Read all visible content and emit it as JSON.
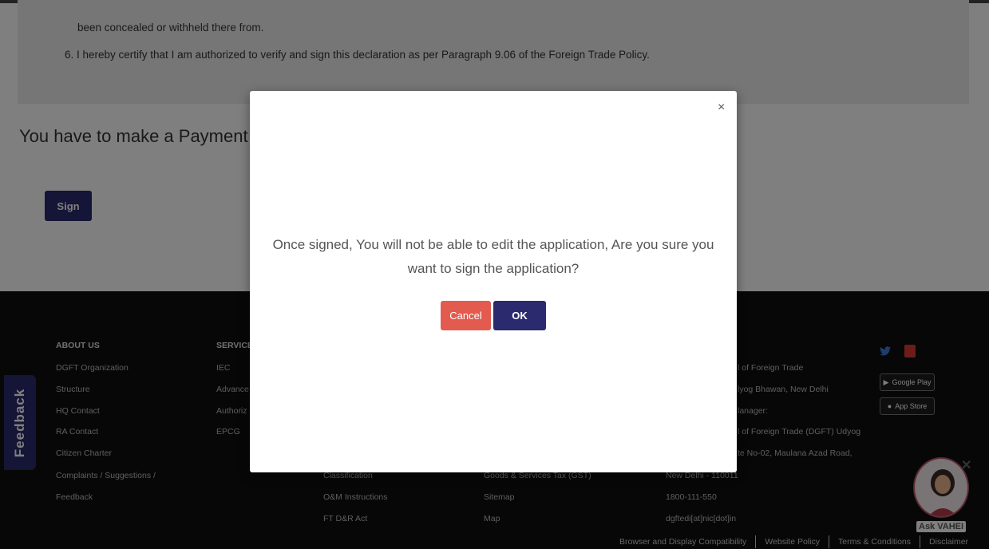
{
  "declaration": {
    "line_1": "been concealed or withheld there from.",
    "line_2": "6. I hereby certify that I am authorized to verify and sign this declaration as per Paragraph 9.06 of the Foreign Trade Policy."
  },
  "payment_heading": "You have to make a Payment O",
  "sign_button": "Sign",
  "footer": {
    "about_us": {
      "heading": "ABOUT US",
      "items": [
        "DGFT Organization",
        "Structure",
        "HQ Contact",
        "RA Contact",
        "Citizen Charter",
        "Complaints / Suggestions /",
        "Feedback"
      ]
    },
    "services": {
      "heading": "SERVICES",
      "items": [
        "IEC",
        "Advance",
        "Authoriz",
        "EPCG"
      ]
    },
    "col3_items": [
      "Classification",
      "O&M Instructions",
      "FT D&R Act"
    ],
    "col4_items": [
      "Goods & Services Tax (GST)",
      "Sitemap",
      "Map"
    ],
    "contact_items": [
      "l of Foreign Trade",
      "lyog Bhawan, New Delhi",
      "lanager:",
      "l of Foreign Trade (DGFT) Udyog",
      "te No-02, Maulana Azad Road,",
      "New Delhi - 110011",
      "1800-111-550",
      "dgftedi[at]nic[dot]in"
    ],
    "google_play_label": "Google Play",
    "app_store_label": "App Store",
    "bottom_links": [
      "Browser and Display Compatibility",
      "Website Policy",
      "Terms & Conditions",
      "Disclaimer"
    ]
  },
  "feedback_tab": "Feedback",
  "assistant": {
    "label": "Ask VAHEI",
    "close": "✕"
  },
  "modal": {
    "close": "×",
    "message": "Once signed, You will not be able to edit the application, Are you sure you want to sign the application?",
    "cancel_label": "Cancel",
    "ok_label": "OK"
  }
}
